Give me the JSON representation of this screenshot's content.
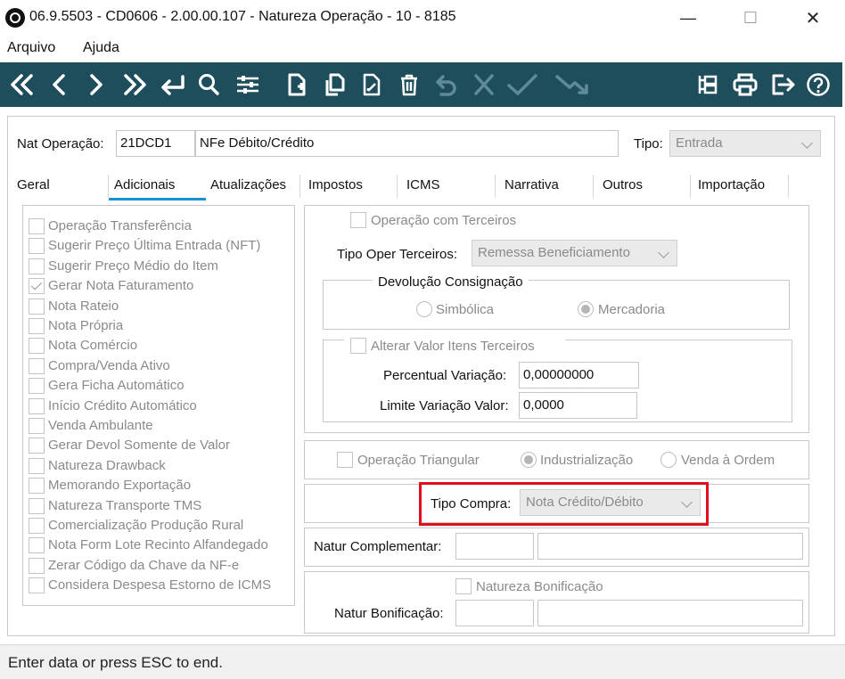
{
  "window": {
    "title": "06.9.5503 - CD0606 - 2.00.00.107 - Natureza Operação - 10 - 8185",
    "minimize": "—",
    "maximize": "☐",
    "close": "✕"
  },
  "menu": {
    "arquivo": "Arquivo",
    "ajuda": "Ajuda"
  },
  "toolbar": {
    "icons": [
      "first-icon",
      "prev-icon",
      "next-icon",
      "last-icon",
      "goto-icon",
      "search-icon",
      "filter-settings-icon",
      "new-doc-icon",
      "copy-icon",
      "edit-doc-icon",
      "delete-icon",
      "undo-icon",
      "cancel-icon",
      "confirm-icon",
      "export-icon",
      "tree-icon",
      "print-icon",
      "exit-icon",
      "help-icon"
    ],
    "colors": {
      "background": "#1e4d5c",
      "icon": "#ffffff",
      "icon_disabled": "#5f8a98"
    }
  },
  "header": {
    "nat_label": "Nat Operação:",
    "nat_code": "21DCD1",
    "nat_desc": "NFe Débito/Crédito",
    "tipo_label": "Tipo:",
    "tipo_value": "Entrada"
  },
  "tabs": [
    "Geral",
    "Adicionais",
    "Atualizações",
    "Impostos",
    "ICMS",
    "Narrativa",
    "Outros",
    "Importação"
  ],
  "active_tab": "Adicionais",
  "left_options": [
    {
      "label": "Operação Transferência",
      "checked": false
    },
    {
      "label": "Sugerir Preço Última Entrada (NFT)",
      "checked": false
    },
    {
      "label": "Sugerir Preço Médio do Item",
      "checked": false
    },
    {
      "label": "Gerar Nota Faturamento",
      "checked": true
    },
    {
      "label": "Nota Rateio",
      "checked": false
    },
    {
      "label": "Nota Própria",
      "checked": false
    },
    {
      "label": "Nota Comércio",
      "checked": false
    },
    {
      "label": "Compra/Venda Ativo",
      "checked": false
    },
    {
      "label": "Gera Ficha Automático",
      "checked": false
    },
    {
      "label": "Início Crédito Automático",
      "checked": false
    },
    {
      "label": "Venda Ambulante",
      "checked": false
    },
    {
      "label": "Gerar Devol Somente de Valor",
      "checked": false
    },
    {
      "label": "Natureza Drawback",
      "checked": false
    },
    {
      "label": "Memorando Exportação",
      "checked": false
    },
    {
      "label": "Natureza Transporte TMS",
      "checked": false
    },
    {
      "label": "Comercialização Produção Rural",
      "checked": false
    },
    {
      "label": "Nota Form Lote Recinto Alfandegado",
      "checked": false
    },
    {
      "label": "Zerar Código da Chave da NF-e",
      "checked": false
    },
    {
      "label": "Considera Despesa Estorno de ICMS",
      "checked": false
    }
  ],
  "terceiros": {
    "op_terceiros": "Operação com Terceiros",
    "tipo_oper_label": "Tipo Oper Terceiros:",
    "tipo_oper_value": "Remessa Beneficiamento",
    "devolucao_title": "Devolução Consignação",
    "simbolica": "Simbólica",
    "mercadoria": "Mercadoria",
    "alterar_valor": "Alterar Valor Itens Terceiros",
    "percentual_label": "Percentual Variação:",
    "percentual_value": "0,00000000",
    "limite_label": "Limite Variação Valor:",
    "limite_value": "0,0000"
  },
  "triangular": {
    "op_triangular": "Operação Triangular",
    "industrializacao": "Industrialização",
    "venda_ordem": "Venda à Ordem"
  },
  "compra": {
    "tipo_compra_label": "Tipo Compra:",
    "tipo_compra_value": "Nota Crédito/Débito"
  },
  "complementar": {
    "label": "Natur Complementar:"
  },
  "bonificacao": {
    "checkbox": "Natureza Bonificação",
    "label": "Natur Bonificação:"
  },
  "status": "Enter data or press ESC to end.",
  "highlight_color": "#e0101a"
}
